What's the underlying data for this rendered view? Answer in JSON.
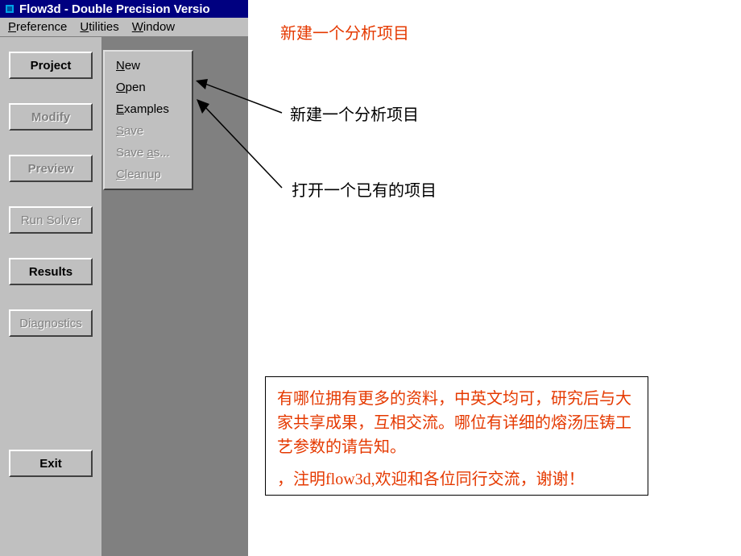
{
  "window": {
    "title": "Flow3d - Double Precision Versio"
  },
  "menubar": {
    "preference": "Preference",
    "utilities": "Utilities",
    "window": "Window"
  },
  "sidebar": {
    "project": "Project",
    "modify": "Modify",
    "preview": "Preview",
    "run_solver": "Run Solver",
    "results": "Results",
    "diagnostics": "Diagnostics",
    "exit": "Exit"
  },
  "popup": {
    "new": "New",
    "open": "Open",
    "examples": "Examples",
    "save": "Save",
    "save_as": "Save as...",
    "cleanup": "Cleanup"
  },
  "annotations": {
    "title_red": "新建一个分析项目",
    "arrow_new": "新建一个分析项目",
    "arrow_open": "打开一个已有的项目",
    "note_p1": "有哪位拥有更多的资料，中英文均可，研究后与大家共享成果，互相交流。哪位有详细的熔汤压铸工艺参数的请告知。",
    "note_p2": "，注明flow3d,欢迎和各位同行交流，谢谢！"
  }
}
